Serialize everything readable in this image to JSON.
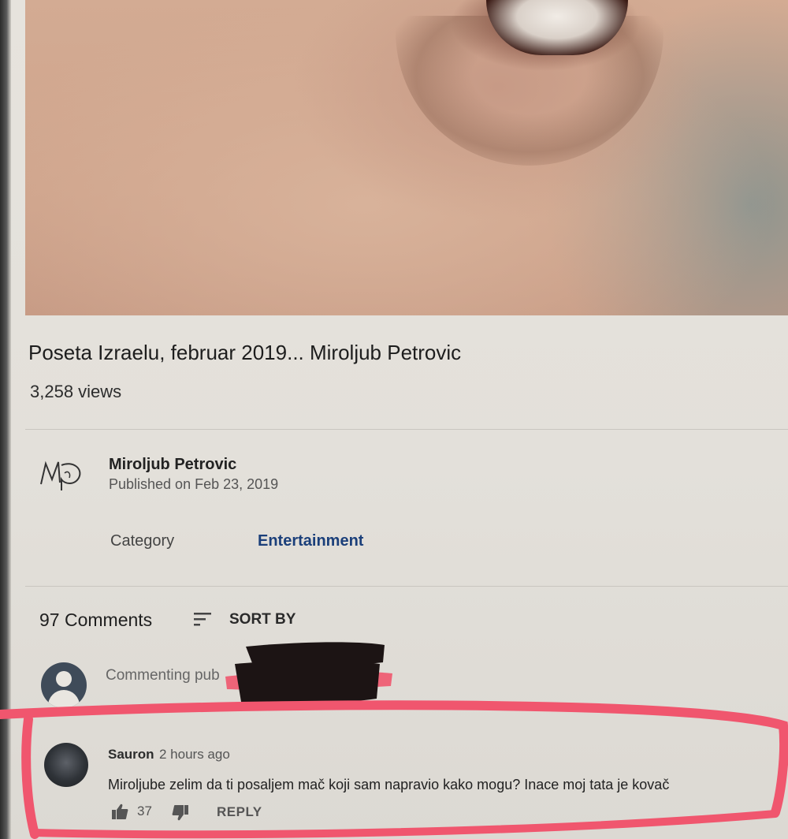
{
  "video": {
    "title": "Poseta Izraelu, februar 2019... Miroljub Petrovic",
    "views": "3,258 views"
  },
  "channel": {
    "name": "Miroljub Petrovic",
    "published": "Published on Feb 23, 2019",
    "logo_text": "MP"
  },
  "metadata": {
    "category_label": "Category",
    "category_value": "Entertainment",
    "category_color": "#1b3f7a"
  },
  "comments": {
    "count_label": "97 Comments",
    "sort_label": "SORT BY",
    "commenting_prefix": "Commenting pub",
    "items": [
      {
        "author": "Sauron",
        "time": "2 hours ago",
        "text": "Miroljube zelim da ti posaljem mač koji sam napravio kako mogu? Inace moj tata je kovač",
        "likes": "37",
        "reply_label": "REPLY"
      }
    ]
  },
  "annotations": {
    "highlight_color": "#f0566e",
    "redaction_color": "#1c1414"
  },
  "icons": [
    "sort-icon",
    "thumbs-up-icon",
    "thumbs-down-icon",
    "avatar-icon"
  ]
}
